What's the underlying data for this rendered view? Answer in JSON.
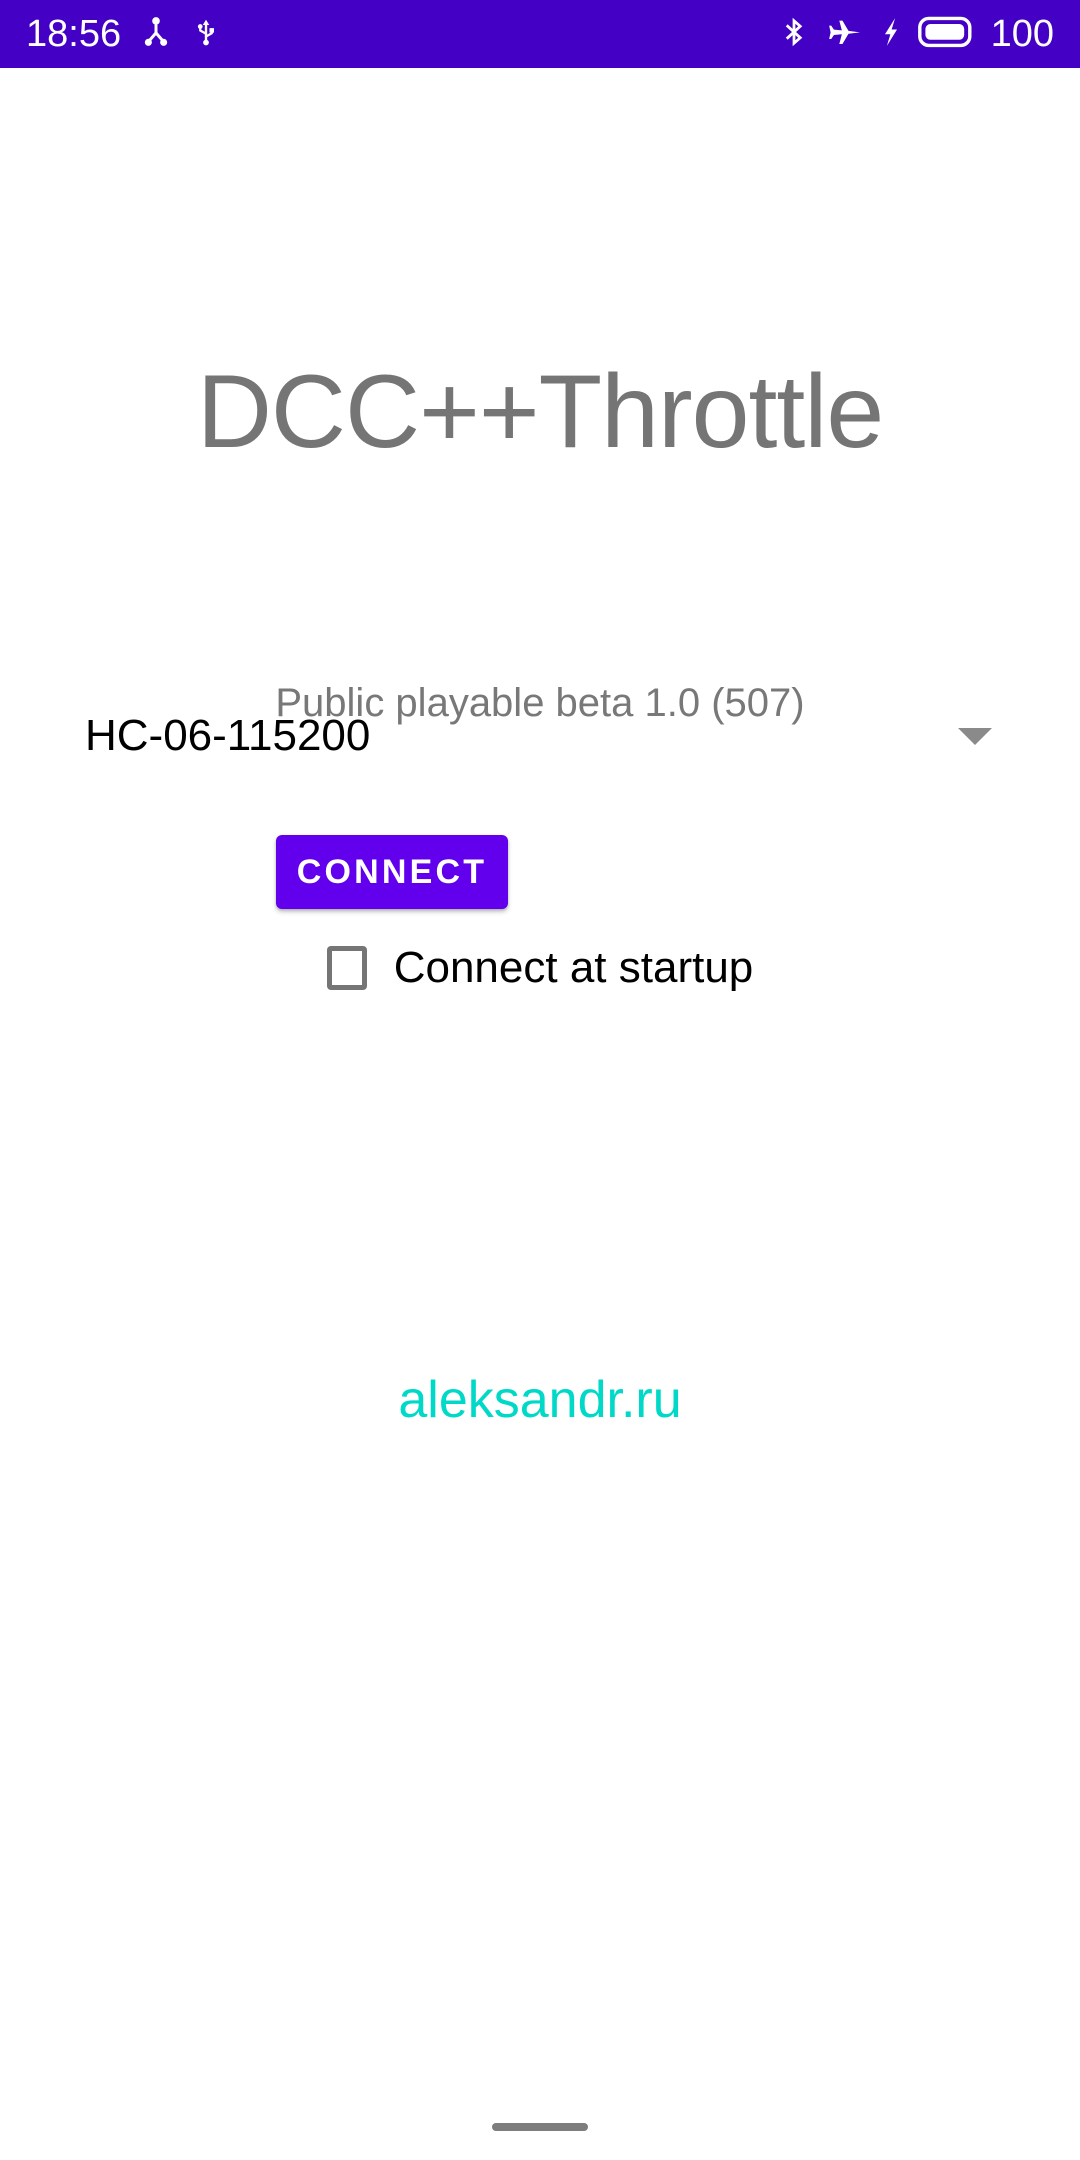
{
  "status_bar": {
    "background_color": "#4400C4",
    "foreground_color": "#FFFFFF",
    "clock": "18:56",
    "battery_percent": "100",
    "left_icons": [
      {
        "name": "accessibility-person-icon"
      },
      {
        "name": "usb-icon"
      }
    ],
    "right_icons": [
      {
        "name": "bluetooth-icon"
      },
      {
        "name": "airplane-mode-icon"
      },
      {
        "name": "charging-bolt-icon"
      },
      {
        "name": "battery-full-icon"
      }
    ]
  },
  "app": {
    "title": "DCC++Throttle",
    "title_color": "#757575",
    "version": "Public playable beta 1.0 (507)",
    "version_color": "#787878"
  },
  "device_spinner": {
    "selected": "HC-06-115200",
    "caret_icon": "chevron-down-icon",
    "options": [
      "HC-06-115200"
    ]
  },
  "connect_button": {
    "label": "CONNECT",
    "background_color": "#6200EE",
    "text_color": "#FFFFFF"
  },
  "startup_checkbox": {
    "label": "Connect at startup",
    "checked": false
  },
  "footer": {
    "link_text": "aleksandr.ru",
    "link_color": "#00D9C8"
  },
  "navigation": {
    "gesture_pill_color": "#7D7D7D"
  }
}
